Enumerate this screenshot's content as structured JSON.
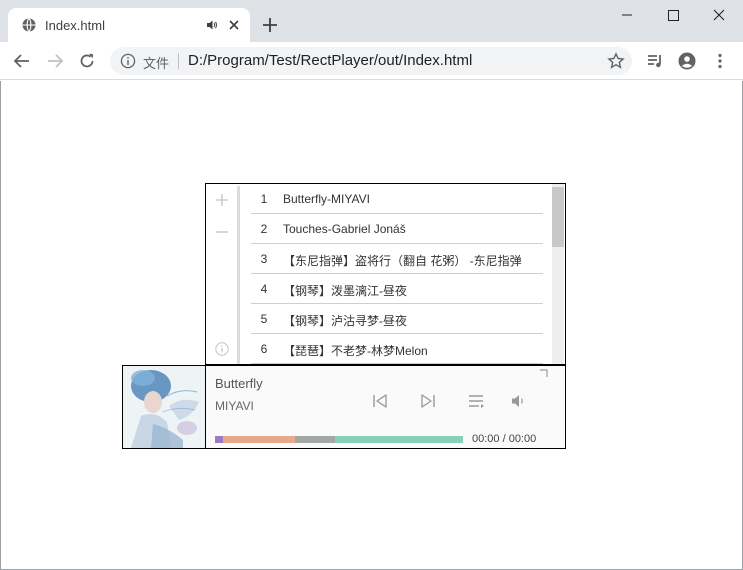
{
  "browser": {
    "tab_title": "Index.html",
    "address_scheme_label": "文件",
    "address_url": "D:/Program/Test/RectPlayer/out/Index.html"
  },
  "player": {
    "playlist": [
      {
        "num": "1",
        "title": "Butterfly-MIYAVI"
      },
      {
        "num": "2",
        "title": "Touches-Gabriel Jonáš"
      },
      {
        "num": "3",
        "title": "【东尼指弹】盗将行（翻自 花粥） -东尼指弹"
      },
      {
        "num": "4",
        "title": "【钢琴】泼墨漓江-昼夜"
      },
      {
        "num": "5",
        "title": "【钢琴】泸沽寻梦-昼夜"
      },
      {
        "num": "6",
        "title": "【琵琶】不老梦-林梦Melon"
      }
    ],
    "now_playing": {
      "title": "Butterfly",
      "artist": "MIYAVI",
      "time": "00:00 / 00:00"
    },
    "colors": {
      "progress_segments": [
        "#9b7bc1",
        "#e7a98b",
        "#a4a8a4",
        "#86d1b7"
      ]
    }
  }
}
